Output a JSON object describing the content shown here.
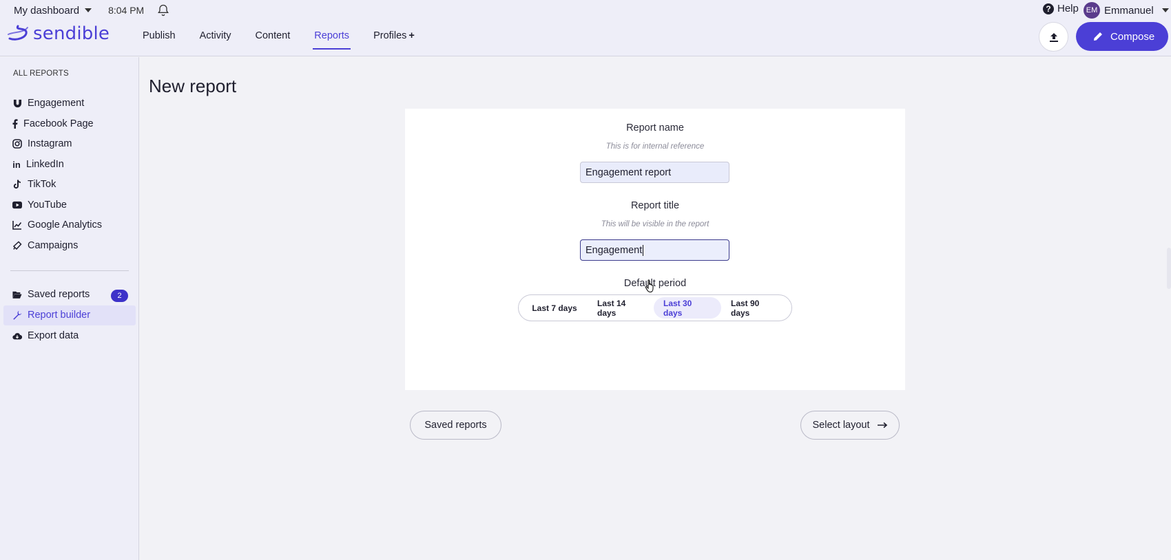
{
  "header": {
    "dashboard_label": "My dashboard",
    "time": "8:04 PM",
    "logo_text": "sendible",
    "nav": [
      {
        "label": "Publish",
        "active": false
      },
      {
        "label": "Activity",
        "active": false
      },
      {
        "label": "Content",
        "active": false
      },
      {
        "label": "Reports",
        "active": true
      },
      {
        "label": "Profiles",
        "active": false
      }
    ],
    "profiles_plus": "+",
    "help_label": "Help",
    "user_initials": "EM",
    "user_name": "Emmanuel",
    "compose_label": "Compose"
  },
  "sidebar": {
    "heading": "ALL REPORTS",
    "items": [
      {
        "label": "Engagement",
        "icon": "magnet-icon"
      },
      {
        "label": "Facebook Page",
        "icon": "facebook-icon"
      },
      {
        "label": "Instagram",
        "icon": "instagram-icon"
      },
      {
        "label": "LinkedIn",
        "icon": "linkedin-icon"
      },
      {
        "label": "TikTok",
        "icon": "tiktok-icon"
      },
      {
        "label": "YouTube",
        "icon": "youtube-icon"
      },
      {
        "label": "Google Analytics",
        "icon": "chart-line-icon"
      },
      {
        "label": "Campaigns",
        "icon": "megaphone-icon"
      }
    ],
    "saved_reports_label": "Saved reports",
    "saved_reports_count": "2",
    "report_builder_label": "Report builder",
    "export_data_label": "Export data"
  },
  "main": {
    "page_title": "New report",
    "report_name_label": "Report name",
    "report_name_hint": "This is for internal reference",
    "report_name_value": "Engagement report",
    "report_title_label": "Report title",
    "report_title_hint": "This will be visible in the report",
    "report_title_value": "Engagement",
    "default_period_label": "Default period",
    "periods": [
      {
        "label": "Last 7 days",
        "active": false
      },
      {
        "label": "Last 14 days",
        "active": false
      },
      {
        "label": "Last 30 days",
        "active": true
      },
      {
        "label": "Last 90 days",
        "active": false
      }
    ],
    "saved_reports_button": "Saved reports",
    "select_layout_button": "Select layout"
  },
  "colors": {
    "accent": "#4b3fd6",
    "header_bg": "#eeeef8",
    "page_bg": "#f2f2f6"
  }
}
